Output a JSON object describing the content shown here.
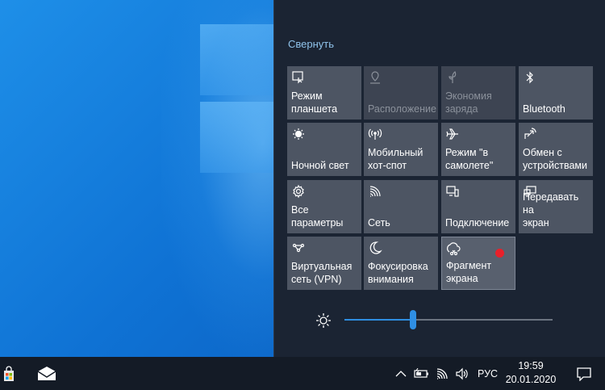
{
  "action_center": {
    "collapse_label": "Свернуть",
    "tiles": [
      {
        "label": "Режим\nпланшета",
        "icon": "tablet-mode-icon",
        "state": "normal"
      },
      {
        "label": "Расположение",
        "icon": "location-icon",
        "state": "disabled"
      },
      {
        "label": "Экономия\nзаряда",
        "icon": "battery-saver-icon",
        "state": "disabled"
      },
      {
        "label": "Bluetooth",
        "icon": "bluetooth-icon",
        "state": "normal"
      },
      {
        "label": "Ночной свет",
        "icon": "night-light-icon",
        "state": "normal"
      },
      {
        "label": "Мобильный\nхот-спот",
        "icon": "hotspot-icon",
        "state": "normal"
      },
      {
        "label": "Режим \"в\nсамолете\"",
        "icon": "airplane-icon",
        "state": "normal"
      },
      {
        "label": "Обмен с\nустройствами",
        "icon": "nearby-share-icon",
        "state": "normal"
      },
      {
        "label": "Все\nпараметры",
        "icon": "gear-icon",
        "state": "normal"
      },
      {
        "label": "Сеть",
        "icon": "network-icon",
        "state": "normal"
      },
      {
        "label": "Подключение",
        "icon": "connect-icon",
        "state": "normal"
      },
      {
        "label": "Передавать на\nэкран",
        "icon": "project-icon",
        "state": "normal"
      },
      {
        "label": "Виртуальная\nсеть (VPN)",
        "icon": "vpn-icon",
        "state": "normal"
      },
      {
        "label": "Фокусировка\nвнимания",
        "icon": "moon-icon",
        "state": "normal"
      },
      {
        "label": "Фрагмент\nэкрана",
        "icon": "snip-icon",
        "state": "selected"
      }
    ],
    "brightness": {
      "value": 0.33
    }
  },
  "taskbar": {
    "language": "РУС",
    "time": "19:59",
    "date": "20.01.2020"
  }
}
